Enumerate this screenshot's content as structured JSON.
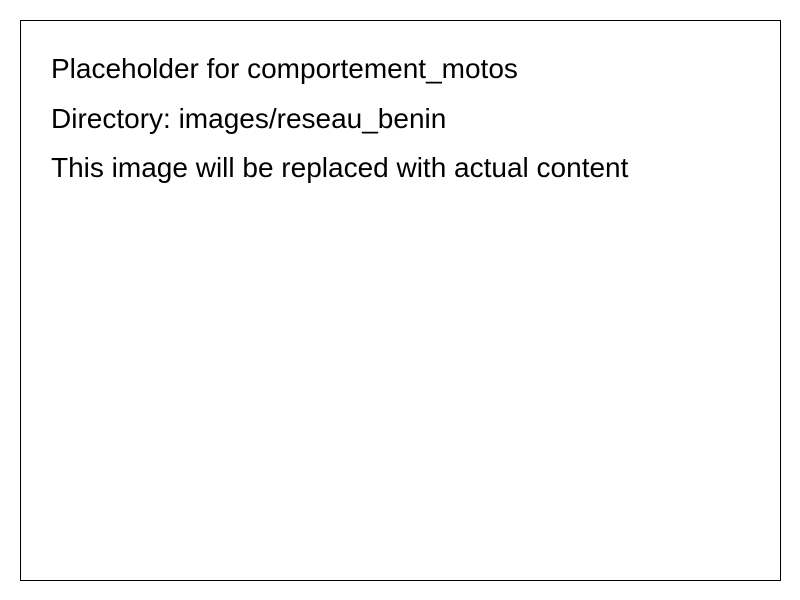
{
  "placeholder": {
    "title": "Placeholder for comportement_motos",
    "directory": "Directory: images/reseau_benin",
    "note": "This image will be replaced with actual content"
  },
  "colors": {
    "background": "#ffffff",
    "border": "#000000",
    "text": "#000000"
  }
}
